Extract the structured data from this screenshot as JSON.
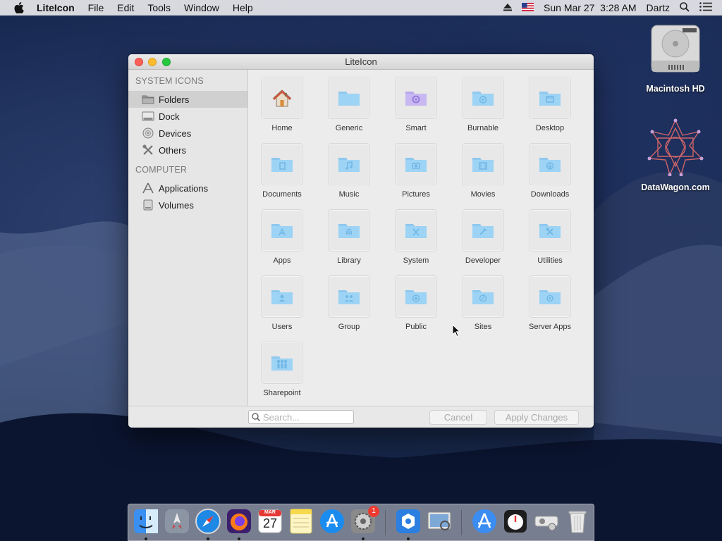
{
  "menubar": {
    "app_name": "LiteIcon",
    "menus": [
      "File",
      "Edit",
      "Tools",
      "Window",
      "Help"
    ],
    "datetime": "Sun Mar 27  3:28 AM",
    "user": "Dartz"
  },
  "desktop": {
    "icons": [
      {
        "label": "Macintosh HD",
        "icon": "hard-drive-icon"
      },
      {
        "label": "DataWagon.com",
        "icon": "datawagon-logo-icon"
      }
    ]
  },
  "window": {
    "title": "LiteIcon",
    "sidebar": {
      "sections": [
        {
          "header": "SYSTEM ICONS",
          "items": [
            {
              "label": "Folders",
              "icon": "folder-icon",
              "selected": true
            },
            {
              "label": "Dock",
              "icon": "dock-icon",
              "selected": false
            },
            {
              "label": "Devices",
              "icon": "disc-icon",
              "selected": false
            },
            {
              "label": "Others",
              "icon": "tools-icon",
              "selected": false
            }
          ]
        },
        {
          "header": "COMPUTER",
          "items": [
            {
              "label": "Applications",
              "icon": "applications-icon",
              "selected": false
            },
            {
              "label": "Volumes",
              "icon": "volume-icon",
              "selected": false
            }
          ]
        }
      ]
    },
    "folders": [
      {
        "label": "Home",
        "icon": "home-icon"
      },
      {
        "label": "Generic",
        "icon": "generic-folder-icon"
      },
      {
        "label": "Smart",
        "icon": "smart-folder-icon"
      },
      {
        "label": "Burnable",
        "icon": "burnable-folder-icon"
      },
      {
        "label": "Desktop",
        "icon": "desktop-folder-icon"
      },
      {
        "label": "Documents",
        "icon": "documents-folder-icon"
      },
      {
        "label": "Music",
        "icon": "music-folder-icon"
      },
      {
        "label": "Pictures",
        "icon": "pictures-folder-icon"
      },
      {
        "label": "Movies",
        "icon": "movies-folder-icon"
      },
      {
        "label": "Downloads",
        "icon": "downloads-folder-icon"
      },
      {
        "label": "Apps",
        "icon": "apps-folder-icon"
      },
      {
        "label": "Library",
        "icon": "library-folder-icon"
      },
      {
        "label": "System",
        "icon": "system-folder-icon"
      },
      {
        "label": "Developer",
        "icon": "developer-folder-icon"
      },
      {
        "label": "Utilities",
        "icon": "utilities-folder-icon"
      },
      {
        "label": "Users",
        "icon": "users-folder-icon"
      },
      {
        "label": "Group",
        "icon": "group-folder-icon"
      },
      {
        "label": "Public",
        "icon": "public-folder-icon"
      },
      {
        "label": "Sites",
        "icon": "sites-folder-icon"
      },
      {
        "label": "Server Apps",
        "icon": "server-apps-folder-icon"
      },
      {
        "label": "Sharepoint",
        "icon": "sharepoint-folder-icon"
      }
    ],
    "search": {
      "placeholder": "Search..."
    },
    "buttons": {
      "cancel": "Cancel",
      "apply": "Apply Changes"
    }
  },
  "dock": {
    "items": [
      {
        "app": "finder-icon",
        "running": true
      },
      {
        "app": "launchpad-icon",
        "running": false
      },
      {
        "app": "safari-icon",
        "running": true
      },
      {
        "app": "firefox-icon",
        "running": true
      },
      {
        "app": "calendar-icon",
        "running": false,
        "month": "MAR",
        "day": "27"
      },
      {
        "app": "notes-icon",
        "running": false
      },
      {
        "app": "app-store-icon",
        "running": false
      },
      {
        "app": "system-preferences-icon",
        "running": true,
        "badge": "1"
      },
      {
        "app": "liteicon-icon",
        "running": true
      },
      {
        "app": "preview-icon",
        "running": false
      },
      {
        "app": "applications-folder-icon",
        "running": false
      },
      {
        "app": "stopwatch-icon",
        "running": false
      },
      {
        "app": "projector-icon",
        "running": false
      },
      {
        "app": "trash-icon",
        "running": false
      }
    ]
  },
  "colors": {
    "folder_blue": "#9dd3f5",
    "folder_glyph": "#6fb6e4",
    "smart_purple": "#b8a6ec",
    "selected_row": "#d0d0d0"
  }
}
